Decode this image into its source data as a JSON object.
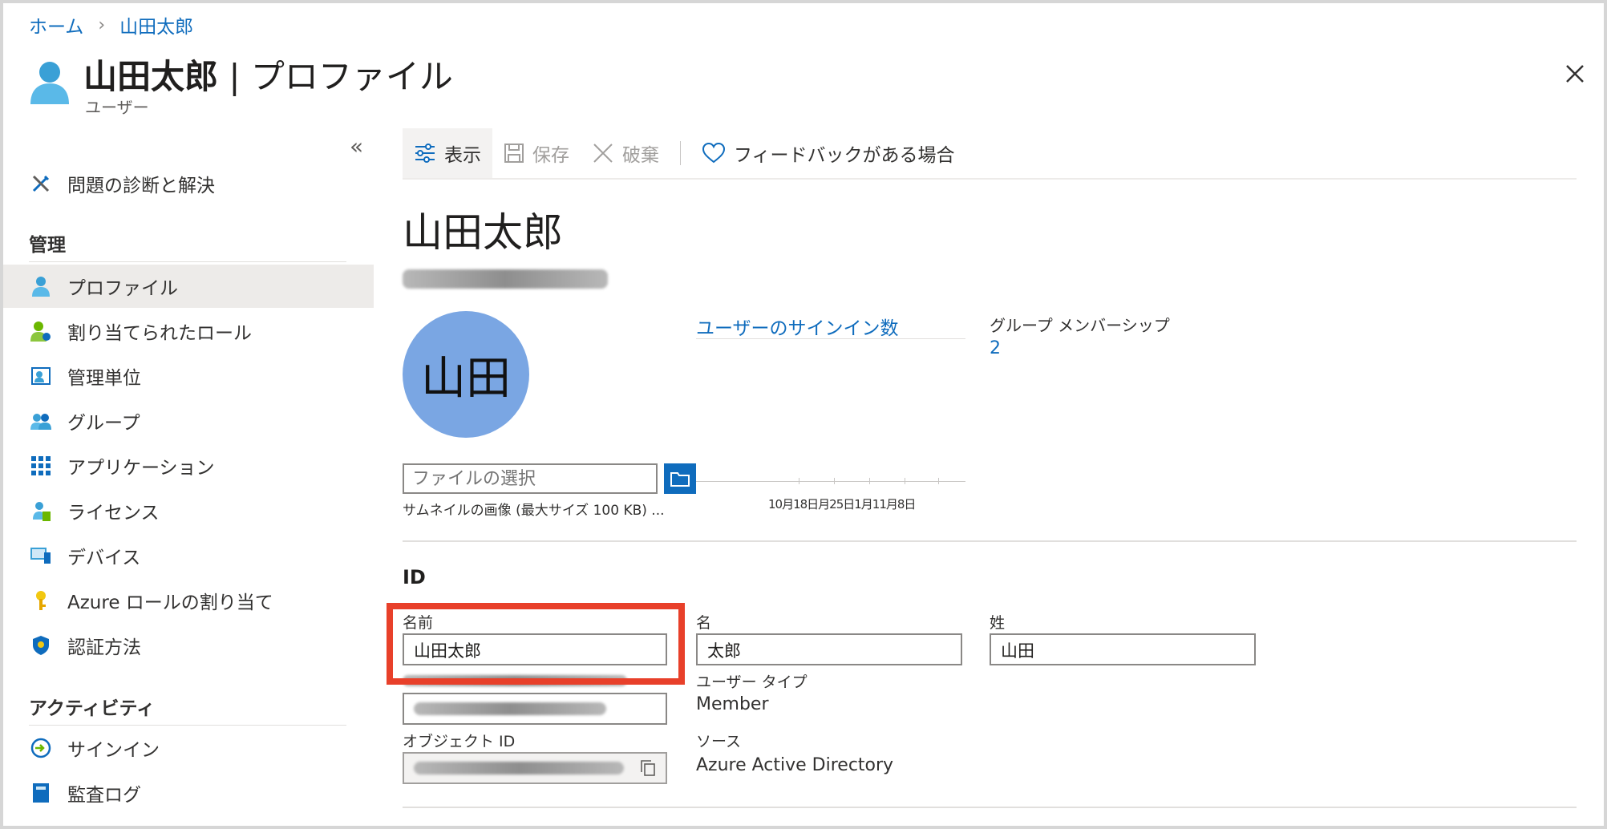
{
  "breadcrumb": {
    "home": "ホーム",
    "current": "山田太郎"
  },
  "header": {
    "title_name": "山田太郎",
    "title_rest": " | プロファイル",
    "subtitle": "ユーザー"
  },
  "sidebar": {
    "top_item": "問題の診断と解決",
    "section_manage": "管理",
    "manage_items": [
      "プロファイル",
      "割り当てられたロール",
      "管理単位",
      "グループ",
      "アプリケーション",
      "ライセンス",
      "デバイス",
      "Azure ロールの割り当て",
      "認証方法"
    ],
    "section_activity": "アクティビティ",
    "activity_items": [
      "サインイン",
      "監査ログ"
    ]
  },
  "toolbar": {
    "view": "表示",
    "save": "保存",
    "discard": "破棄",
    "feedback": "フィードバックがある場合"
  },
  "profile": {
    "display_name": "山田太郎",
    "avatar_initials": "山田",
    "signin_link": "ユーザーのサインイン数",
    "group_label": "グループ メンバーシップ",
    "group_count": "2",
    "file_placeholder": "ファイルの選択",
    "thumbnail_note": "サムネイルの画像 (最大サイズ 100 KB) ...",
    "chart_ticks": "10月18日月25日1月11月8日"
  },
  "identity": {
    "section_title": "ID",
    "name_label": "名前",
    "name_value": "山田太郎",
    "first_label": "名",
    "first_value": "太郎",
    "last_label": "姓",
    "last_value": "山田",
    "user_type_label": "ユーザー タイプ",
    "user_type_value": "Member",
    "object_id_label": "オブジェクト ID",
    "source_label": "ソース",
    "source_value": "Azure Active Directory"
  },
  "colors": {
    "accent": "#0f6cbd",
    "avatar": "#7aa6e3",
    "highlight": "#e8402a"
  }
}
